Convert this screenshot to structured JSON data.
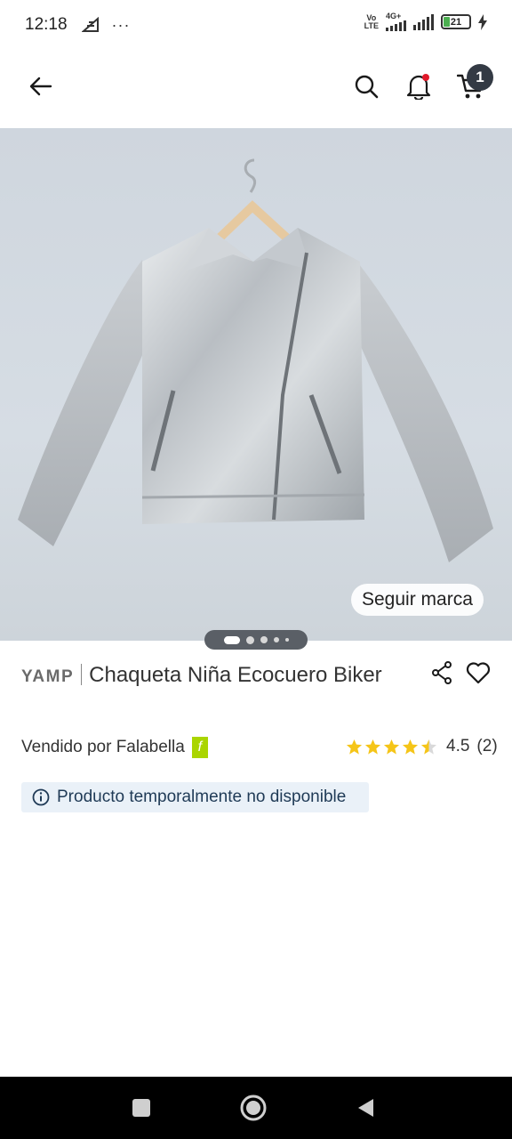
{
  "status_bar": {
    "time": "12:18",
    "overflow": "···",
    "network_label_top": "Vo",
    "network_label_bottom": "LTE",
    "network_type": "4G+",
    "battery_level": "21"
  },
  "header": {
    "cart_count": "1"
  },
  "image": {
    "follow_brand_label": "Seguir marca",
    "carousel_pages": 5,
    "carousel_active_index": 0
  },
  "product": {
    "brand": "YAMP",
    "title": "Chaqueta Niña Ecocuero Biker",
    "seller_text": "Vendido por Falabella",
    "seller_badge": "f",
    "rating_value": "4.5",
    "rating_count": "(2)",
    "availability": "Producto temporalmente no disponible"
  },
  "colors": {
    "seller_badge": "#aad500",
    "star": "#f5c518",
    "alert_bg": "#eaf1f8",
    "alert_text": "#1f3a56",
    "badge_bg": "#333a44",
    "bell_dot": "#e0192a"
  },
  "icons": {
    "back": "arrow-left-icon",
    "search": "search-icon",
    "bell": "bell-icon",
    "cart": "cart-icon",
    "share": "share-icon",
    "heart": "heart-icon",
    "info": "info-icon"
  }
}
